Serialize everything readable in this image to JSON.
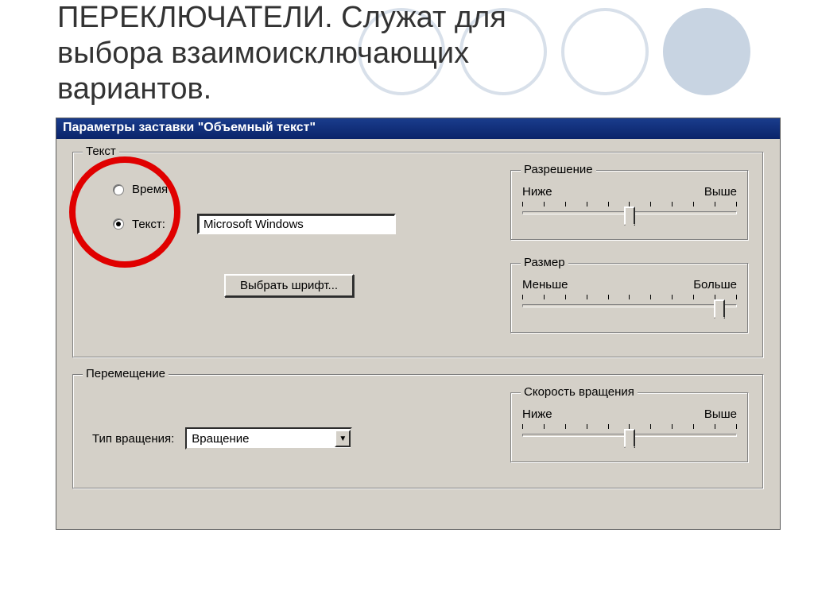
{
  "slide": {
    "title": "ПЕРЕКЛЮЧАТЕЛИ. Служат для выбора взаимоисключающих вариантов."
  },
  "dialog": {
    "title": "Параметры заставки \"Объемный текст\""
  },
  "text_group": {
    "label": "Текст",
    "radio_time": "Время",
    "radio_text": "Текст:",
    "text_value": "Microsoft Windows",
    "font_button": "Выбрать шрифт..."
  },
  "resolution": {
    "label": "Разрешение",
    "low": "Ниже",
    "high": "Выше",
    "value_pct": 50
  },
  "size": {
    "label": "Размер",
    "low": "Меньше",
    "high": "Больше",
    "value_pct": 92
  },
  "movement": {
    "label": "Перемещение",
    "rotation_label": "Тип вращения:",
    "rotation_value": "Вращение"
  },
  "speed": {
    "label": "Скорость вращения",
    "low": "Ниже",
    "high": "Выше",
    "value_pct": 50
  }
}
